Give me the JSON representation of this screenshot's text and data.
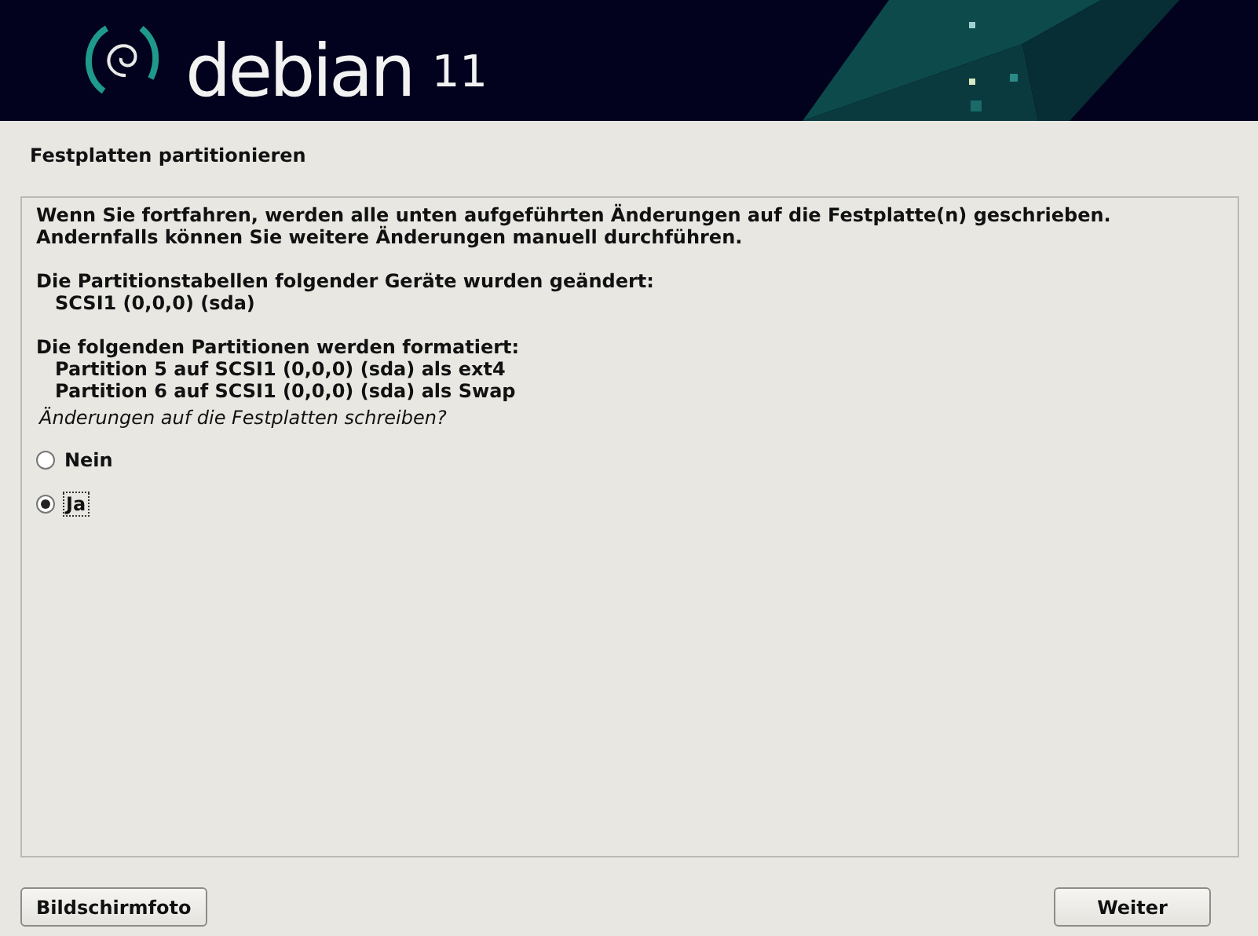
{
  "banner": {
    "logo_text": "debian",
    "version": "11"
  },
  "step_title": "Festplatten partitionieren",
  "blocks": [
    {
      "lines": [
        "Wenn Sie fortfahren, werden alle unten aufgeführten Änderungen auf die Festplatte(n) geschrieben.",
        "Andernfalls können Sie weitere Änderungen manuell durchführen."
      ]
    },
    {
      "lines": [
        "Die Partitionstabellen folgender Geräte wurden geändert:"
      ],
      "items": [
        "SCSI1 (0,0,0) (sda)"
      ]
    },
    {
      "lines": [
        "Die folgenden Partitionen werden formatiert:"
      ],
      "items": [
        "Partition 5 auf SCSI1 (0,0,0) (sda) als ext4",
        "Partition 6 auf SCSI1 (0,0,0) (sda) als Swap"
      ]
    }
  ],
  "question": "Änderungen auf die Festplatten schreiben?",
  "options": [
    {
      "label": "Nein",
      "selected": false
    },
    {
      "label": "Ja",
      "selected": true
    }
  ],
  "buttons": {
    "left": "Bildschirmfoto",
    "right": "Weiter"
  }
}
